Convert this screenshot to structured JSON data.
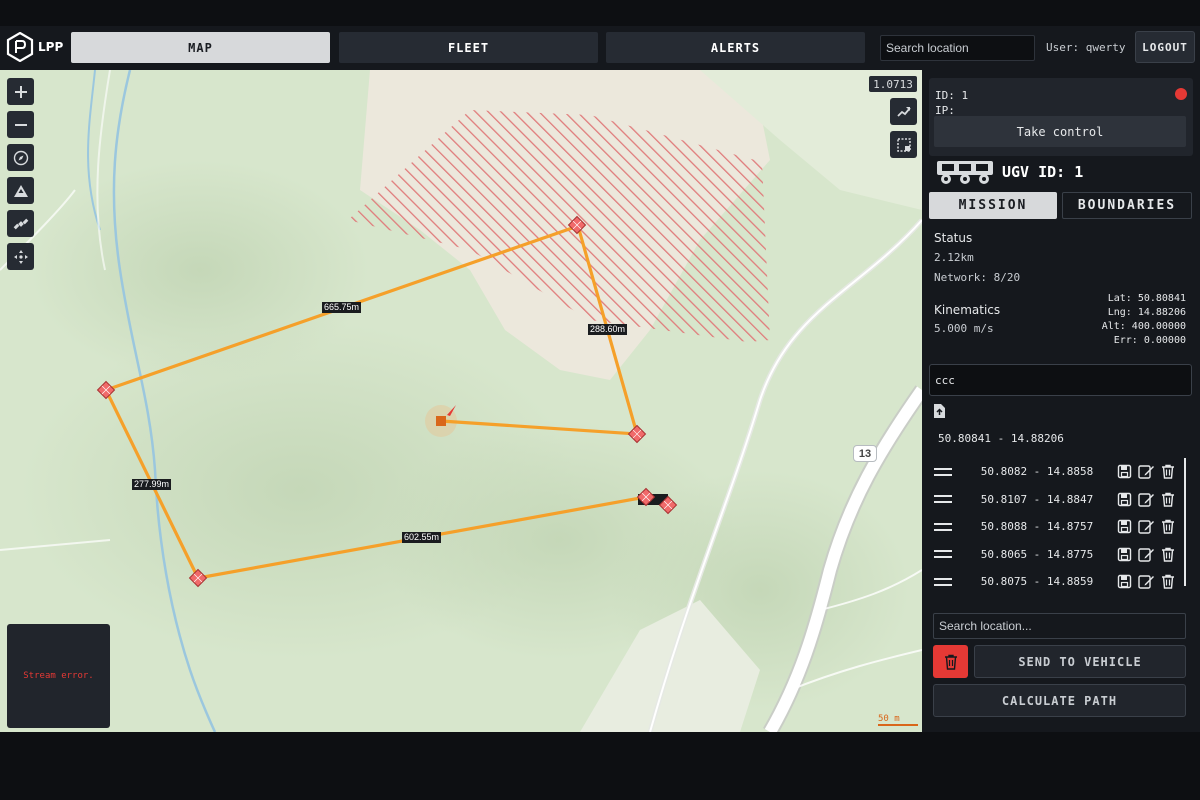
{
  "app": {
    "logo_text": "LPP"
  },
  "nav": {
    "tabs": [
      {
        "label": "MAP",
        "active": true
      },
      {
        "label": "FLEET",
        "active": false
      },
      {
        "label": "ALERTS",
        "active": false
      }
    ],
    "search_placeholder": "Search location",
    "user_label": "User: qwerty",
    "logout_label": "LOGOUT"
  },
  "map": {
    "zoom_readout": "1.0713",
    "route_distances": [
      "665.75m",
      "288.60m",
      "277.99m",
      "602.55m"
    ],
    "road_number": "13",
    "stream_error": "Stream error.",
    "scale_label": "50 m",
    "tools": [
      "zoom-in-icon",
      "zoom-out-icon",
      "compass-icon",
      "terrain-icon",
      "satellite-icon",
      "move-icon"
    ],
    "colors": {
      "route": "#f5a02a",
      "waypoint": "#f06a6a",
      "no_go_zone": "#e07b7b",
      "vehicle": "#d9661a"
    }
  },
  "vehicle_card": {
    "id_line": "ID: 1",
    "ip_line": "IP:",
    "take_control_label": "Take control",
    "status_color": "#e53935"
  },
  "ugv": {
    "title": "UGV ID: 1",
    "tabs": [
      {
        "label": "MISSION",
        "active": true
      },
      {
        "label": "BOUNDARIES",
        "active": false
      }
    ]
  },
  "status": {
    "title": "Status",
    "distance": "2.12km",
    "network": "Network: 8/20"
  },
  "kinematics": {
    "title": "Kinematics",
    "speed": "5.000 m/s",
    "lat": "Lat: 50.80841",
    "lng": "Lng: 14.88206",
    "alt": "Alt: 400.00000",
    "err": "Err: 0.00000"
  },
  "mission": {
    "note_value": "ccc",
    "current_position": "50.80841  -  14.88206",
    "waypoints": [
      "50.8082  -  14.8858",
      "50.8107  -  14.8847",
      "50.8088  -  14.8757",
      "50.8065  -  14.8775",
      "50.8075  -  14.8859"
    ],
    "search_placeholder": "Search location...",
    "send_label": "SEND TO VEHICLE",
    "calc_label": "CALCULATE PATH",
    "delete_color": "#e53935"
  }
}
